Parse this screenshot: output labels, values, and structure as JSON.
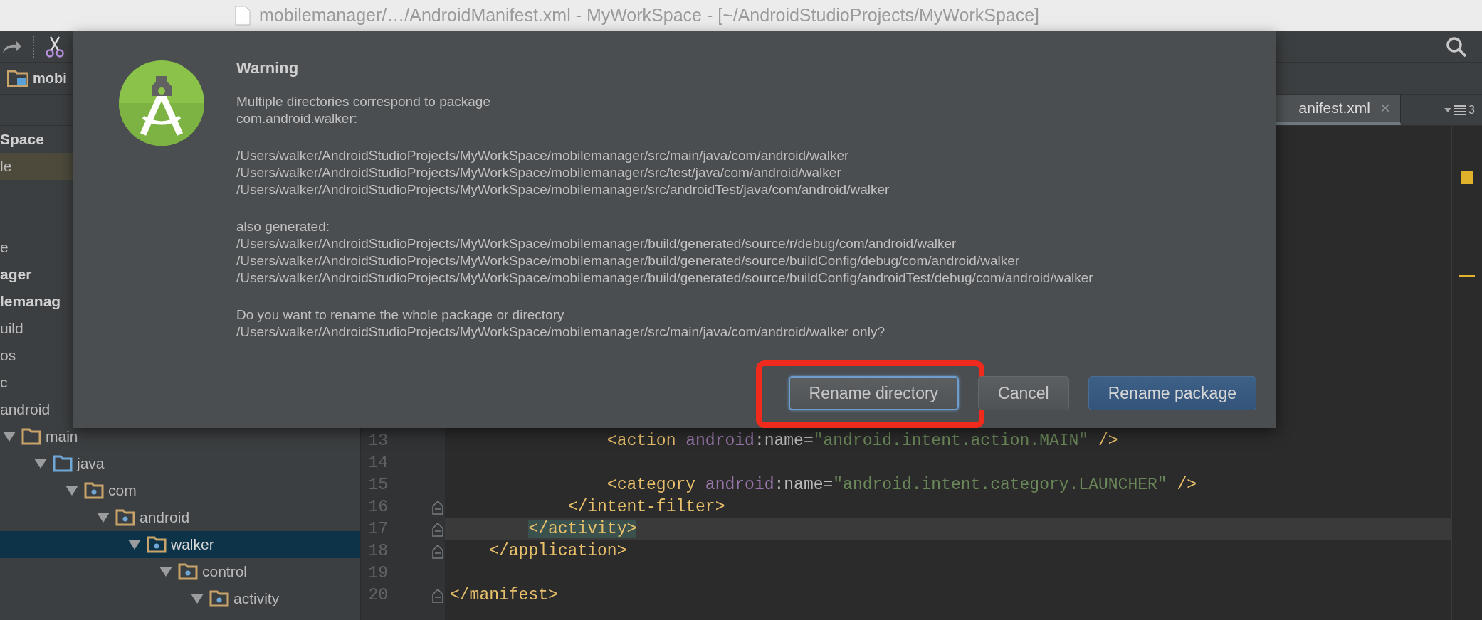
{
  "window": {
    "title": "mobilemanager/…/AndroidManifest.xml - MyWorkSpace - [~/AndroidStudioProjects/MyWorkSpace]"
  },
  "breadcrumb": {
    "label": "mobi"
  },
  "editor_tabs": [
    {
      "label": "anifest.xml",
      "close": "×",
      "selected": true
    }
  ],
  "tab_overflow": {
    "count": "3"
  },
  "project_panel": {
    "header": "Space",
    "upper_rows": [
      {
        "label": "le",
        "highlighted": true
      }
    ],
    "lower_rows": [
      {
        "label": "e",
        "bold": false
      },
      {
        "label": "ager",
        "bold": true
      },
      {
        "label": "lemanag",
        "bold": true
      },
      {
        "label": "uild",
        "bold": false
      },
      {
        "label": "os",
        "bold": false
      },
      {
        "label": "c",
        "bold": false
      },
      {
        "label": "android",
        "bold": false
      }
    ],
    "tree": [
      {
        "label": "main",
        "kind": "folder",
        "expanded": true,
        "selected": false,
        "children": [
          {
            "label": "java",
            "kind": "source-root",
            "expanded": true,
            "selected": false,
            "children": [
              {
                "label": "com",
                "kind": "package",
                "expanded": true,
                "selected": false,
                "children": [
                  {
                    "label": "android",
                    "kind": "package",
                    "expanded": true,
                    "selected": false,
                    "children": [
                      {
                        "label": "walker",
                        "kind": "package",
                        "expanded": true,
                        "selected": true,
                        "children": [
                          {
                            "label": "control",
                            "kind": "package",
                            "expanded": true,
                            "selected": false,
                            "children": [
                              {
                                "label": "activity",
                                "kind": "package",
                                "expanded": true,
                                "selected": false
                              }
                            ]
                          }
                        ]
                      }
                    ]
                  }
                ]
              }
            ]
          }
        ]
      }
    ]
  },
  "editor": {
    "lines": [
      {
        "children": [
          {
            "children": [
              {
                "children": [
                  {
                    "children": [
                      {
                        "number": "13",
                        "current": false,
                        "fold": false,
                        "tokens": [
                          {
                            "kind": "tag",
                            "text": "<action"
                          },
                          {
                            "kind": "ns",
                            "text": " android"
                          },
                          {
                            "kind": "attr",
                            "text": ":name="
                          },
                          {
                            "kind": "string",
                            "text": "\"android.intent.action.MAIN\""
                          },
                          {
                            "kind": "tag",
                            "text": " />"
                          }
                        ]
                      },
                      {
                        "number": "14",
                        "current": false,
                        "fold": false
                      },
                      {
                        "number": "15",
                        "current": false,
                        "fold": false,
                        "tokens": [
                          {
                            "kind": "tag",
                            "text": "<category"
                          },
                          {
                            "kind": "ns",
                            "text": " android"
                          },
                          {
                            "kind": "attr",
                            "text": ":name="
                          },
                          {
                            "kind": "string",
                            "text": "\"android.intent.category.LAUNCHER\""
                          },
                          {
                            "kind": "tag",
                            "text": " />"
                          }
                        ]
                      }
                    ]
                  },
                  {
                    "number": "16",
                    "current": false,
                    "fold": true,
                    "tokens": [
                      {
                        "kind": "tag",
                        "text": "</intent-filter>"
                      }
                    ]
                  }
                ]
              },
              {
                "number": "17",
                "current": true,
                "fold": true,
                "tokens": [
                  {
                    "kind": "tag-match",
                    "text": "</activity>"
                  }
                ]
              }
            ]
          },
          {
            "number": "18",
            "current": false,
            "fold": true,
            "tokens": [
              {
                "kind": "tag",
                "text": "</application>"
              }
            ]
          }
        ]
      },
      {
        "number": "19",
        "current": false,
        "fold": false
      },
      {
        "number": "20",
        "current": false,
        "fold": true,
        "tokens": [
          {
            "kind": "tag",
            "text": "</manifest>"
          }
        ]
      }
    ]
  },
  "dialog": {
    "title": "Warning",
    "paragraphs": [
      [
        "Multiple directories correspond to package",
        "com.android.walker:"
      ],
      [
        "/Users/walker/AndroidStudioProjects/MyWorkSpace/mobilemanager/src/main/java/com/android/walker",
        "/Users/walker/AndroidStudioProjects/MyWorkSpace/mobilemanager/src/test/java/com/android/walker",
        "/Users/walker/AndroidStudioProjects/MyWorkSpace/mobilemanager/src/androidTest/java/com/android/walker"
      ],
      [
        "also generated:",
        "/Users/walker/AndroidStudioProjects/MyWorkSpace/mobilemanager/build/generated/source/r/debug/com/android/walker",
        "/Users/walker/AndroidStudioProjects/MyWorkSpace/mobilemanager/build/generated/source/buildConfig/debug/com/android/walker",
        "/Users/walker/AndroidStudioProjects/MyWorkSpace/mobilemanager/build/generated/source/buildConfig/androidTest/debug/com/android/walker"
      ],
      [
        "Do you want to rename the whole package or directory",
        "/Users/walker/AndroidStudioProjects/MyWorkSpace/mobilemanager/src/main/java/com/android/walker only?"
      ]
    ],
    "buttons": [
      {
        "label": "Rename directory",
        "focused": true,
        "default": false,
        "annotated": true
      },
      {
        "label": "Cancel",
        "focused": false,
        "default": false,
        "annotated": false
      },
      {
        "label": "Rename package",
        "focused": false,
        "default": true,
        "annotated": false
      }
    ]
  }
}
